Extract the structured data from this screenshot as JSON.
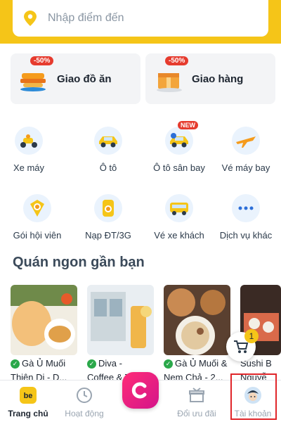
{
  "search": {
    "placeholder": "Nhập điểm đến"
  },
  "services": [
    {
      "label": "Giao đồ ăn",
      "badge": "-50%"
    },
    {
      "label": "Giao hàng",
      "badge": "-50%"
    }
  ],
  "grid": [
    {
      "label": "Xe máy",
      "icon": "motorbike-icon"
    },
    {
      "label": "Ô tô",
      "icon": "car-icon"
    },
    {
      "label": "Ô tô sân bay",
      "icon": "airport-car-icon",
      "badge": "NEW"
    },
    {
      "label": "Vé máy bay",
      "icon": "airplane-icon"
    },
    {
      "label": "Gói hội viên",
      "icon": "membership-icon"
    },
    {
      "label": "Nạp ĐT/3G",
      "icon": "topup-icon"
    },
    {
      "label": "Vé xe khách",
      "icon": "bus-icon"
    },
    {
      "label": "Dịch vụ khác",
      "icon": "more-icon"
    }
  ],
  "section_title": "Quán ngon gần bạn",
  "shops": [
    {
      "line1": "Gà Ủ Muối",
      "line2": "Thiên Di - D..."
    },
    {
      "line1": "Diva -",
      "line2": "Coffee & Tea"
    },
    {
      "line1": "Gà Ủ Muối &",
      "line2": "Nem Chả - 2..."
    },
    {
      "line1": "Sushi B",
      "line2": "Nguyễ"
    }
  ],
  "cart": {
    "count": "1"
  },
  "nav": [
    {
      "label": "Trang chủ",
      "active": true
    },
    {
      "label": "Hoạt động"
    },
    {
      "label": "Đổi ưu đãi"
    },
    {
      "label": "Tài khoản"
    }
  ],
  "colors": {
    "brand_yellow": "#f5c518",
    "badge_red": "#e63b2e",
    "highlight_red": "#e0262a",
    "center_pink": "#ff2d77"
  }
}
